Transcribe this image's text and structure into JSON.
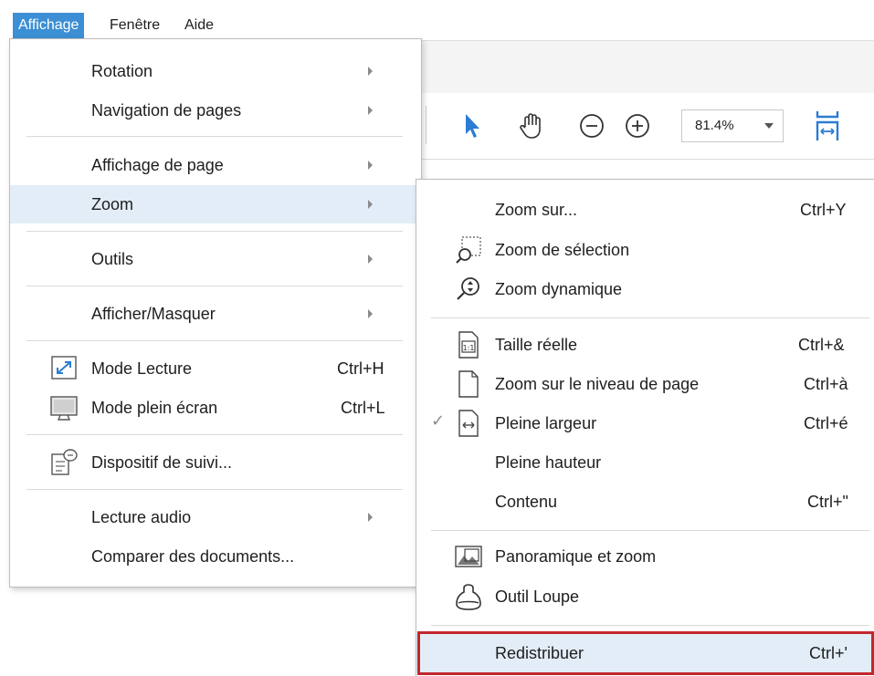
{
  "menubar": {
    "items": [
      {
        "label": "Affichage"
      },
      {
        "label": "Fenêtre"
      },
      {
        "label": "Aide"
      }
    ]
  },
  "toolbar": {
    "zoom_value": "81.4%"
  },
  "view_menu": {
    "rotation": "Rotation",
    "navigation": "Navigation de pages",
    "page_display": "Affichage de page",
    "zoom": "Zoom",
    "tools": "Outils",
    "show_hide": "Afficher/Masquer",
    "reading_mode": "Mode Lecture",
    "reading_mode_shortcut": "Ctrl+H",
    "full_screen": "Mode plein écran",
    "full_screen_shortcut": "Ctrl+L",
    "tracker": "Dispositif de suivi...",
    "read_aloud": "Lecture audio",
    "compare": "Comparer des documents..."
  },
  "zoom_menu": {
    "zoom_to": "Zoom sur...",
    "zoom_to_shortcut": "Ctrl+Y",
    "marquee_zoom": "Zoom de sélection",
    "dynamic_zoom": "Zoom dynamique",
    "actual_size": "Taille réelle",
    "actual_size_shortcut": "Ctrl+&",
    "fit_page": "Zoom sur le niveau de page",
    "fit_page_shortcut": "Ctrl+à",
    "fit_width": "Pleine largeur",
    "fit_width_shortcut": "Ctrl+é",
    "fit_width_checked": true,
    "fit_height": "Pleine hauteur",
    "fit_visible": "Contenu",
    "fit_visible_shortcut": "Ctrl+\"",
    "pan_zoom": "Panoramique et zoom",
    "loupe": "Outil Loupe",
    "reflow": "Redistribuer",
    "reflow_shortcut": "Ctrl+'"
  },
  "icons": {
    "checkmark": "✓",
    "accent": "#3c8fd4",
    "highlight_border": "#c1272d"
  }
}
